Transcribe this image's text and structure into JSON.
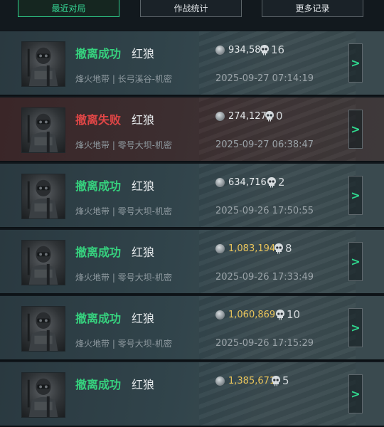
{
  "tabs": [
    {
      "label": "最近对局",
      "active": true
    },
    {
      "label": "作战统计",
      "active": false
    },
    {
      "label": "更多记录",
      "active": false
    }
  ],
  "records": [
    {
      "status": "撤离成功",
      "result": "success",
      "operator": "红狼",
      "location": "烽火地带 | 长弓溪谷-机密",
      "value": "934,587",
      "value_highlight": false,
      "kills": "16",
      "time": "2025-09-27 07:14:19"
    },
    {
      "status": "撤离失败",
      "result": "fail",
      "operator": "红狼",
      "location": "烽火地带 | 零号大坝-机密",
      "value": "274,127",
      "value_highlight": false,
      "kills": "0",
      "time": "2025-09-27 06:38:47"
    },
    {
      "status": "撤离成功",
      "result": "success",
      "operator": "红狼",
      "location": "烽火地带 | 零号大坝-机密",
      "value": "634,716",
      "value_highlight": false,
      "kills": "2",
      "time": "2025-09-26 17:50:55"
    },
    {
      "status": "撤离成功",
      "result": "success",
      "operator": "红狼",
      "location": "烽火地带 | 零号大坝-机密",
      "value": "1,083,194",
      "value_highlight": true,
      "kills": "8",
      "time": "2025-09-26 17:33:49"
    },
    {
      "status": "撤离成功",
      "result": "success",
      "operator": "红狼",
      "location": "烽火地带 | 零号大坝-机密",
      "value": "1,060,869",
      "value_highlight": true,
      "kills": "10",
      "time": "2025-09-26 17:15:29"
    },
    {
      "status": "撤离成功",
      "result": "success",
      "operator": "红狼",
      "location": "",
      "value": "1,385,671",
      "value_highlight": true,
      "kills": "5",
      "time": ""
    }
  ],
  "icons": {
    "coin": "coin-icon",
    "kills": "skull-icon",
    "detail": "chevron-right-icon",
    "avatar": "operator-avatar"
  },
  "detail_arrow": ">",
  "colors": {
    "accent": "#2fcf8b",
    "success": "#36d17e",
    "fail": "#e04646",
    "gold": "#e8c35a"
  }
}
